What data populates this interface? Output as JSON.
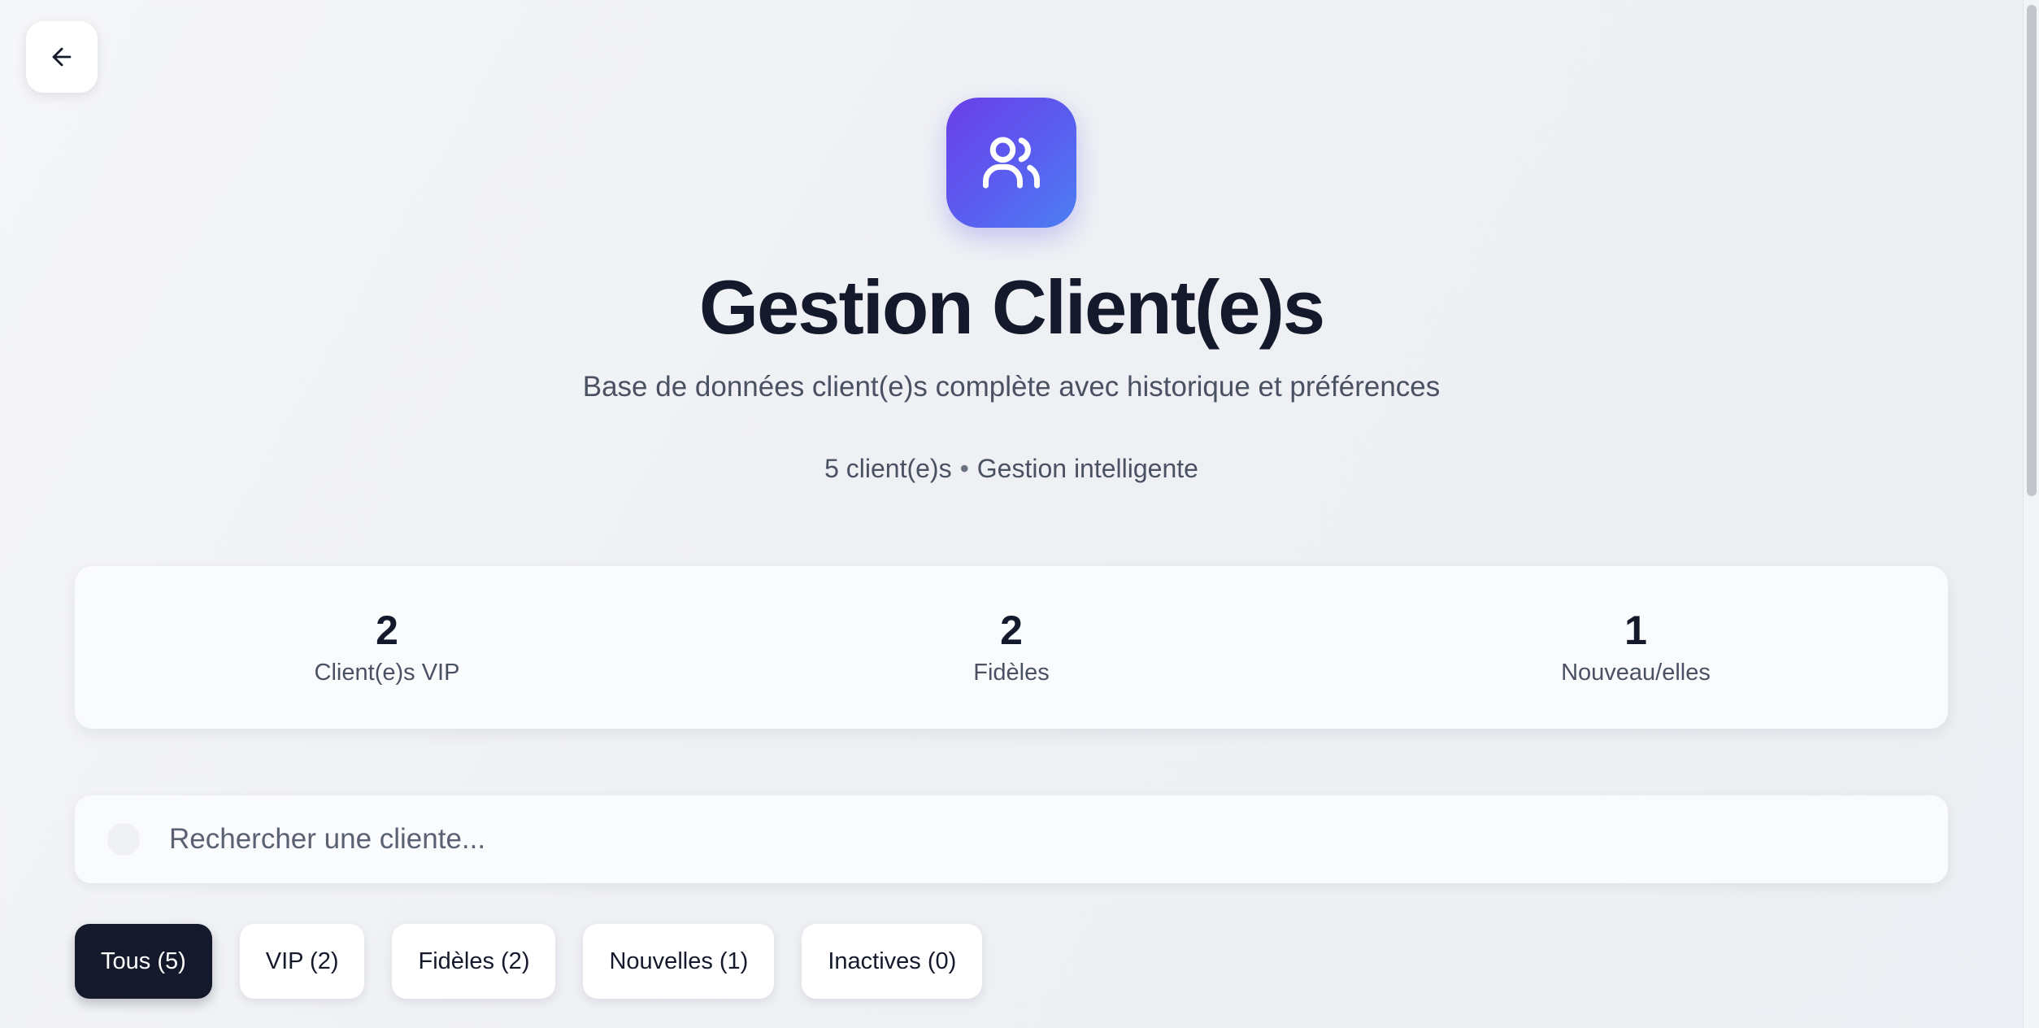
{
  "header": {
    "back_icon": "arrow-left-icon",
    "hero_icon": "users-icon",
    "title": "Gestion Client(e)s",
    "subtitle": "Base de données client(e)s complète avec historique et préférences",
    "meta": {
      "count_text": "5 client(e)s",
      "separator": "•",
      "tagline": "Gestion intelligente"
    }
  },
  "stats": [
    {
      "value": "2",
      "label": "Client(e)s VIP"
    },
    {
      "value": "2",
      "label": "Fidèles"
    },
    {
      "value": "1",
      "label": "Nouveau/elles"
    }
  ],
  "search": {
    "icon": "search-icon",
    "placeholder": "Rechercher une cliente...",
    "value": ""
  },
  "filters": [
    {
      "label": "Tous (5)",
      "active": true
    },
    {
      "label": "VIP (2)",
      "active": false
    },
    {
      "label": "Fidèles (2)",
      "active": false
    },
    {
      "label": "Nouvelles (1)",
      "active": false
    },
    {
      "label": "Inactives (0)",
      "active": false
    }
  ],
  "colors": {
    "accent_gradient_start": "#6a3fe8",
    "accent_gradient_end": "#4b7ef2",
    "active_chip": "#141a2b",
    "text_primary": "#141a2b",
    "text_secondary": "#4a5163"
  }
}
